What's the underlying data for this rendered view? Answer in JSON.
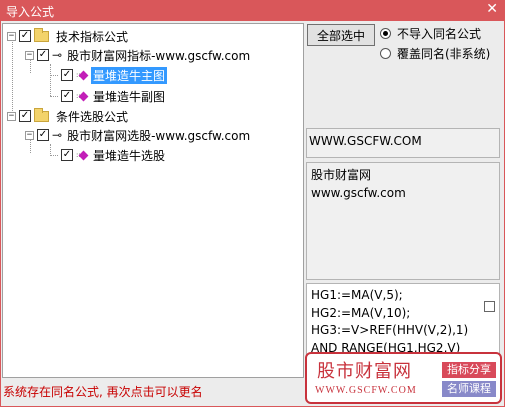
{
  "window": {
    "title": "导入公式",
    "close_glyph": "✕"
  },
  "tree": {
    "items": [
      {
        "label": "技术指标公式",
        "checked": true,
        "type": "folder"
      },
      {
        "label": "股市财富网指标-www.gscfw.com",
        "checked": true,
        "type": "key"
      },
      {
        "label": "量堆造牛主图",
        "checked": true,
        "type": "formula",
        "selected": true
      },
      {
        "label": "量堆造牛副图",
        "checked": true,
        "type": "formula"
      },
      {
        "label": "条件选股公式",
        "checked": true,
        "type": "folder"
      },
      {
        "label": "股市财富网选股-www.gscfw.com",
        "checked": true,
        "type": "key"
      },
      {
        "label": "量堆造牛选股",
        "checked": true,
        "type": "formula"
      }
    ],
    "expander_glyph": "−",
    "check_glyph": "✓"
  },
  "options": {
    "select_all_label": "全部选中",
    "radio_skip_label": "不导入同名公式",
    "radio_overwrite_label": "覆盖同名(非系统)",
    "selected": "skip"
  },
  "info": {
    "url": "WWW.GSCFW.COM",
    "desc_line1": "股市财富网",
    "desc_line2": "www.gscfw.com"
  },
  "code": {
    "lines": [
      "HG1:=MA(V,5);",
      "HG2:=MA(V,10);",
      "HG3:=V>REF(HHV(V,2),1)",
      "AND RANGE(HG1,HG2,V)"
    ]
  },
  "watermark": {
    "title": "股市财富网",
    "url": "WWW.GSCFW.COM",
    "tag1": "指标分享",
    "tag2": "名师课程",
    "color": "#c8323c"
  },
  "status": {
    "message": "系统存在同名公式, 再次点击可以更名"
  },
  "colors": {
    "titlebar": "#d9575a",
    "selection": "#3399ff",
    "status": "#c80000"
  }
}
